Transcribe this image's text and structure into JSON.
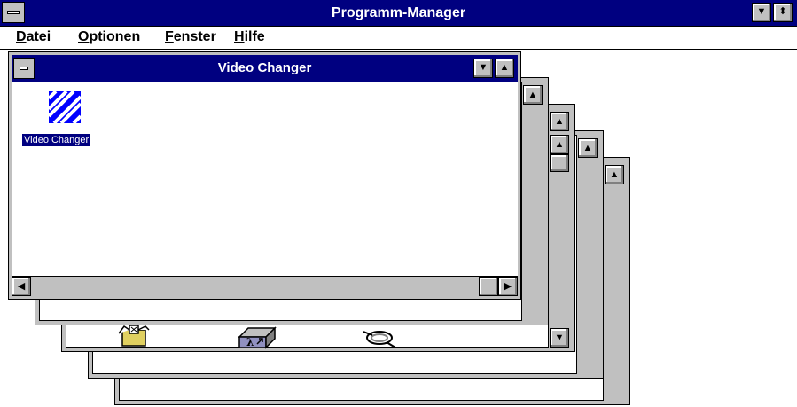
{
  "app": {
    "title": "Programm-Manager"
  },
  "menu": {
    "items": [
      {
        "mnemonic": "D",
        "rest": "atei"
      },
      {
        "mnemonic": "O",
        "rest": "ptionen"
      },
      {
        "mnemonic": "F",
        "rest": "enster"
      },
      {
        "mnemonic": "H",
        "rest": "ilfe"
      }
    ]
  },
  "active_window": {
    "title": "Video Changer",
    "icon_label": "Video Changer",
    "icon_name": "video-changer-icon"
  },
  "background_windows": {
    "visible_icons": [
      "package-icon",
      "pif-editor-icon",
      "cable-icon"
    ]
  },
  "colors": {
    "titlebar": "#000080",
    "face": "#c0c0c0",
    "window": "#ffffff",
    "selection": "#000080",
    "icon_blue": "#0000ff"
  },
  "glyphs": {
    "min": "▼",
    "restore": "⬍",
    "up": "▲",
    "down": "▼",
    "left": "◀",
    "right": "▶"
  }
}
